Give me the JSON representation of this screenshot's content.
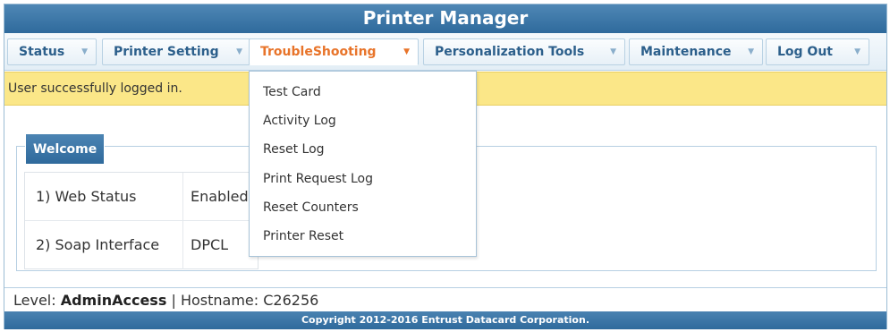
{
  "app": {
    "title": "Printer Manager"
  },
  "menu": {
    "items": [
      {
        "label": "Status"
      },
      {
        "label": "Printer Setting"
      },
      {
        "label": "TroubleShooting"
      },
      {
        "label": "Personalization Tools"
      },
      {
        "label": "Maintenance"
      },
      {
        "label": "Log Out"
      }
    ],
    "caret_icon": "caret-down-icon",
    "active_index": 2
  },
  "dropdown": {
    "items": [
      "Test Card",
      "Activity Log",
      "Reset Log",
      "Print Request Log",
      "Reset Counters",
      "Printer Reset"
    ]
  },
  "notice": {
    "text": "User successfully logged in."
  },
  "welcome": {
    "legend": "Welcome",
    "rows": [
      {
        "label": "1) Web Status",
        "value": "Enabled"
      },
      {
        "label": "2) Soap Interface",
        "value": "DPCL"
      }
    ]
  },
  "status": {
    "level_label": "Level:",
    "level_value": "AdminAccess",
    "separator": "|",
    "hostname_label": "Hostname:",
    "hostname_value": "C26256"
  },
  "footer": {
    "copyright": "Copyright 2012-2016 Entrust Datacard Corporation."
  },
  "colors": {
    "brand_blue": "#2f6a9c",
    "active_menu": "#e8742a",
    "notice_bg": "#fbe788"
  }
}
